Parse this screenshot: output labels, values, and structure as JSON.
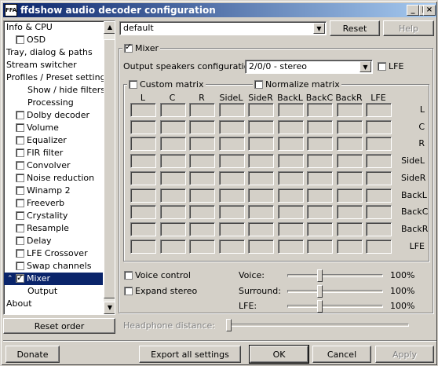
{
  "window": {
    "title": "ffdshow audio decoder configuration",
    "icon": "FFA"
  },
  "title_buttons": {
    "minimize": "_",
    "maximize": "□",
    "close": "×"
  },
  "tree": [
    {
      "label": "Info & CPU",
      "indent": 0,
      "checkbox": null
    },
    {
      "label": "OSD",
      "indent": 1,
      "checkbox": false
    },
    {
      "label": "Tray, dialog & paths",
      "indent": 0,
      "checkbox": null
    },
    {
      "label": "Stream switcher",
      "indent": 0,
      "checkbox": null
    },
    {
      "label": "Profiles / Preset settings",
      "indent": 0,
      "checkbox": null
    },
    {
      "label": "Show / hide filters",
      "indent": 2,
      "checkbox": null
    },
    {
      "label": "Processing",
      "indent": 2,
      "checkbox": null
    },
    {
      "label": "Dolby decoder",
      "indent": 1,
      "checkbox": false
    },
    {
      "label": "Volume",
      "indent": 1,
      "checkbox": false
    },
    {
      "label": "Equalizer",
      "indent": 1,
      "checkbox": false
    },
    {
      "label": "FIR filter",
      "indent": 1,
      "checkbox": false
    },
    {
      "label": "Convolver",
      "indent": 1,
      "checkbox": false
    },
    {
      "label": "Noise reduction",
      "indent": 1,
      "checkbox": false
    },
    {
      "label": "Winamp 2",
      "indent": 1,
      "checkbox": false
    },
    {
      "label": "Freeverb",
      "indent": 1,
      "checkbox": false
    },
    {
      "label": "Crystality",
      "indent": 1,
      "checkbox": false
    },
    {
      "label": "Resample",
      "indent": 1,
      "checkbox": false
    },
    {
      "label": "Delay",
      "indent": 1,
      "checkbox": false
    },
    {
      "label": "LFE Crossover",
      "indent": 1,
      "checkbox": false
    },
    {
      "label": "Swap channels",
      "indent": 1,
      "checkbox": false
    },
    {
      "label": "Mixer",
      "indent": 1,
      "checkbox": true,
      "selected": true
    },
    {
      "label": "Output",
      "indent": 2,
      "checkbox": null
    },
    {
      "label": "About",
      "indent": 0,
      "checkbox": null
    }
  ],
  "reset_order": "Reset order",
  "preset": {
    "value": "default",
    "reset": "Reset",
    "help": "Help"
  },
  "mixer": {
    "label": "Mixer",
    "checked": true
  },
  "speakers": {
    "label": "Output speakers configuration:",
    "value": "2/0/0 - stereo",
    "lfe_label": "LFE",
    "lfe_checked": false
  },
  "matrix": {
    "custom_label": "Custom matrix",
    "normalize_label": "Normalize matrix",
    "columns": [
      "L",
      "C",
      "R",
      "SideL",
      "SideR",
      "BackL",
      "BackC",
      "BackR",
      "LFE"
    ],
    "rows": [
      "L",
      "C",
      "R",
      "SideL",
      "SideR",
      "BackL",
      "BackC",
      "BackR",
      "LFE"
    ]
  },
  "voice_control": "Voice control",
  "expand_stereo": "Expand stereo",
  "sliders": [
    {
      "label": "Voice:",
      "value": "100%"
    },
    {
      "label": "Surround:",
      "value": "100%"
    },
    {
      "label": "LFE:",
      "value": "100%"
    }
  ],
  "headphone": "Headphone distance:",
  "bottom": {
    "donate": "Donate",
    "export": "Export all settings",
    "ok": "OK",
    "cancel": "Cancel",
    "apply": "Apply"
  }
}
